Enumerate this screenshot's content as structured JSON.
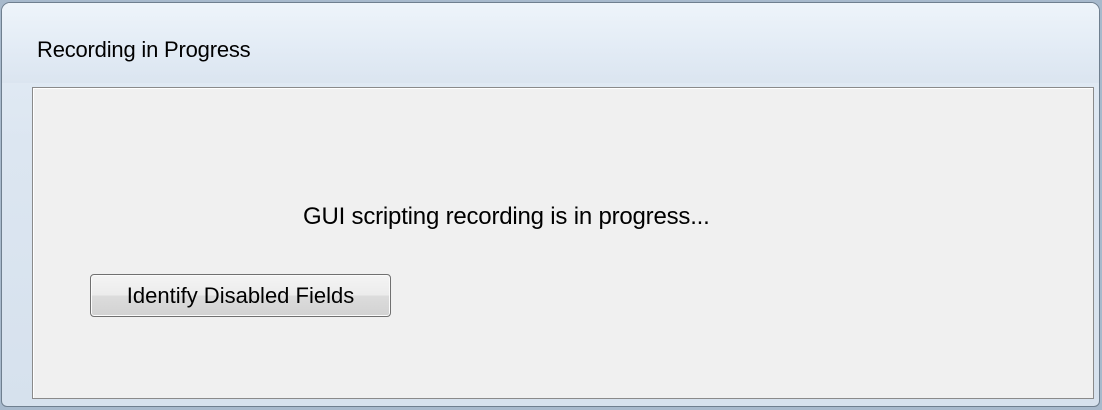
{
  "window": {
    "title": "Recording in Progress"
  },
  "content": {
    "message": "GUI scripting recording is in progress...",
    "identify_button_label": "Identify Disabled Fields"
  }
}
